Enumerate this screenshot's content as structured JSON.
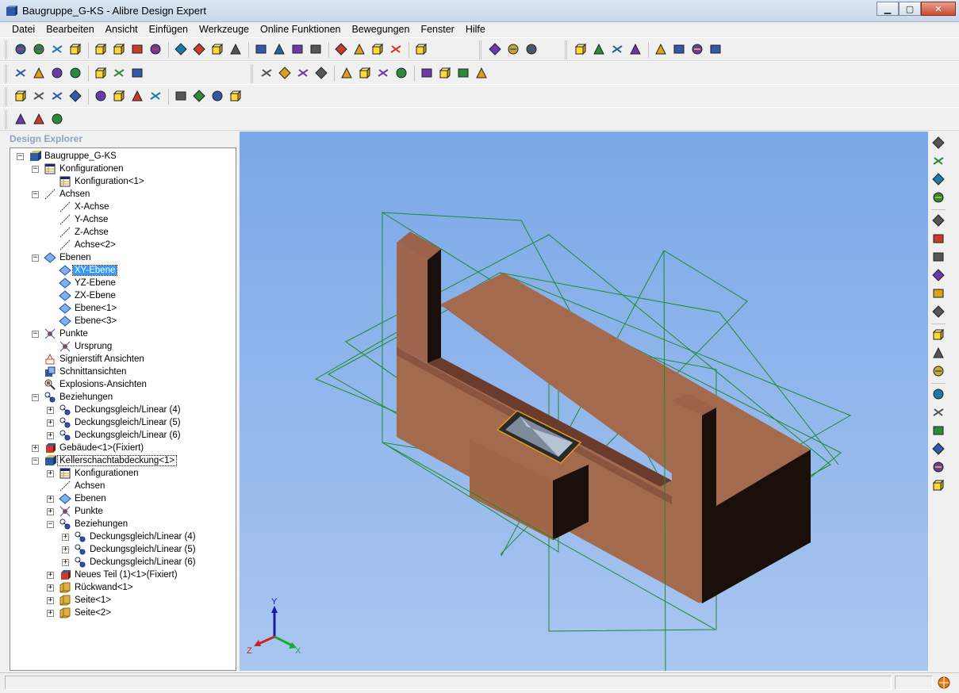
{
  "window": {
    "title": "Baugruppe_G-KS - Alibre Design Expert",
    "icon": "alibre-assembly-icon"
  },
  "menubar": [
    "Datei",
    "Bearbeiten",
    "Ansicht",
    "Einfügen",
    "Werkzeuge",
    "Online Funktionen",
    "Bewegungen",
    "Fenster",
    "Hilfe"
  ],
  "explorer": {
    "title": "Design Explorer",
    "tree": [
      {
        "level": 0,
        "toggle": "-",
        "icon": "assembly-icon",
        "label": "Baugruppe_G-KS"
      },
      {
        "level": 1,
        "toggle": "-",
        "icon": "configurations-icon",
        "label": "Konfigurationen"
      },
      {
        "level": 2,
        "toggle": "",
        "icon": "configuration-icon",
        "label": "Konfiguration<1>"
      },
      {
        "level": 1,
        "toggle": "-",
        "icon": "axes-icon",
        "label": "Achsen"
      },
      {
        "level": 2,
        "toggle": "",
        "icon": "axis-icon",
        "label": "X-Achse"
      },
      {
        "level": 2,
        "toggle": "",
        "icon": "axis-icon",
        "label": "Y-Achse"
      },
      {
        "level": 2,
        "toggle": "",
        "icon": "axis-icon",
        "label": "Z-Achse"
      },
      {
        "level": 2,
        "toggle": "",
        "icon": "axis-icon",
        "label": "Achse<2>"
      },
      {
        "level": 1,
        "toggle": "-",
        "icon": "planes-icon",
        "label": "Ebenen"
      },
      {
        "level": 2,
        "toggle": "",
        "icon": "plane-icon",
        "label": "XY-Ebene",
        "selected": true
      },
      {
        "level": 2,
        "toggle": "",
        "icon": "plane-icon",
        "label": "YZ-Ebene"
      },
      {
        "level": 2,
        "toggle": "",
        "icon": "plane-icon",
        "label": "ZX-Ebene"
      },
      {
        "level": 2,
        "toggle": "",
        "icon": "plane-icon",
        "label": "Ebene<1>"
      },
      {
        "level": 2,
        "toggle": "",
        "icon": "plane-icon",
        "label": "Ebene<3>"
      },
      {
        "level": 1,
        "toggle": "-",
        "icon": "points-icon",
        "label": "Punkte"
      },
      {
        "level": 2,
        "toggle": "",
        "icon": "point-icon",
        "label": "Ursprung"
      },
      {
        "level": 1,
        "toggle": "",
        "icon": "signature-pen-icon",
        "label": "Signierstift Ansichten"
      },
      {
        "level": 1,
        "toggle": "",
        "icon": "section-views-icon",
        "label": "Schnittansichten"
      },
      {
        "level": 1,
        "toggle": "",
        "icon": "exploded-views-icon",
        "label": "Explosions-Ansichten"
      },
      {
        "level": 1,
        "toggle": "-",
        "icon": "constraints-icon",
        "label": "Beziehungen"
      },
      {
        "level": 2,
        "toggle": "+",
        "icon": "constraint-icon",
        "label": "Deckungsgleich/Linear (4)"
      },
      {
        "level": 2,
        "toggle": "+",
        "icon": "constraint-icon",
        "label": "Deckungsgleich/Linear (5)"
      },
      {
        "level": 2,
        "toggle": "+",
        "icon": "constraint-icon",
        "label": "Deckungsgleich/Linear (6)"
      },
      {
        "level": 1,
        "toggle": "+",
        "icon": "part-fixed-icon",
        "label": "Gebäude<1>(Fixiert)"
      },
      {
        "level": 1,
        "toggle": "-",
        "icon": "subassembly-icon",
        "label": "Kellerschachtabdeckung<1>",
        "focused": true
      },
      {
        "level": 2,
        "toggle": "+",
        "icon": "configurations-icon",
        "label": "Konfigurationen"
      },
      {
        "level": 2,
        "toggle": "",
        "icon": "axes-icon",
        "label": "Achsen"
      },
      {
        "level": 2,
        "toggle": "+",
        "icon": "planes-icon",
        "label": "Ebenen"
      },
      {
        "level": 2,
        "toggle": "+",
        "icon": "points-icon",
        "label": "Punkte"
      },
      {
        "level": 2,
        "toggle": "-",
        "icon": "constraints-icon",
        "label": "Beziehungen"
      },
      {
        "level": 3,
        "toggle": "+",
        "icon": "constraint-icon",
        "label": "Deckungsgleich/Linear (4)"
      },
      {
        "level": 3,
        "toggle": "+",
        "icon": "constraint-icon",
        "label": "Deckungsgleich/Linear (5)"
      },
      {
        "level": 3,
        "toggle": "+",
        "icon": "constraint-icon",
        "label": "Deckungsgleich/Linear (6)"
      },
      {
        "level": 2,
        "toggle": "+",
        "icon": "part-fixed-icon",
        "label": "Neues Teil (1)<1>(Fixiert)"
      },
      {
        "level": 2,
        "toggle": "+",
        "icon": "sheet-part-icon",
        "label": "Rückwand<1>"
      },
      {
        "level": 2,
        "toggle": "+",
        "icon": "sheet-part-icon",
        "label": "Seite<1>"
      },
      {
        "level": 2,
        "toggle": "+",
        "icon": "sheet-part-icon",
        "label": "Seite<2>"
      }
    ]
  },
  "viewport": {
    "triad": {
      "x": "X",
      "y": "Y",
      "z": "Z"
    },
    "colors": {
      "background_top": "#7aa8e8",
      "background_bottom": "#a9c6f0",
      "solid": "#a46a4e",
      "shadow": "#1a0f0a",
      "planes": "#1f8a2a",
      "highlight": "#e59a1e"
    }
  },
  "toolbars": {
    "row1": [
      "new-icon",
      "open-icon",
      "save-icon",
      "paste-special-icon",
      "copy-special-icon",
      "print-icon",
      "print-preview-icon",
      "cut-icon",
      "copy-icon",
      "paste-icon",
      "delete-icon",
      "undo-icon",
      "redo-icon",
      "select-icon",
      "box-select-icon",
      "lasso-icon",
      "zoom-in-icon",
      "zoom-window-icon",
      "zoom-fit-icon",
      "previous-view-icon",
      "next-view-icon",
      "insert-part-icon",
      "insert-subassembly-icon",
      "render-icon",
      "plane-tool-icon",
      "axis-tool-icon",
      "point-tool-icon",
      "table-icon",
      "constraint-tool-icon",
      "measure-icon",
      "balance-icon",
      "interference-icon"
    ],
    "row2": [
      "part-color-icon",
      "assembly-color-icon",
      "sketch-icon",
      "sketch-3d-icon",
      "plane-sketch-icon",
      "point-sketch-icon",
      "marker-icon",
      "iso-view-icon",
      "front-view-icon",
      "back-view-icon",
      "left-view-icon",
      "right-view-icon",
      "top-view-icon",
      "bottom-view-icon",
      "grid-icon",
      "wireframe-icon",
      "shaded-icon",
      "magnet-icon",
      "origin-icon"
    ],
    "row3": [
      "assembly-tree-icon",
      "solid-icon",
      "explode-icon",
      "constraint-a-icon",
      "constraint-b-icon",
      "constraint-c-icon",
      "constraint-d-icon",
      "constraint-e-icon",
      "constraint-f-icon",
      "constraint-g-icon",
      "constraint-h-icon",
      "constraint-i-icon"
    ],
    "row4": [
      "pdf-icon",
      "animation-icon",
      "screenshot-icon"
    ],
    "right": [
      "view-cube-icon",
      "grid-dots-icon",
      "arrow-small-icon",
      "hexagon-icon",
      "gear-gray-icon",
      "insert-assembly-icon",
      "insert-part-right-icon",
      "add-part-icon",
      "replace-part-icon",
      "move-part-icon",
      "rotate-part-icon",
      "formula-icon",
      "gear-dim-icon",
      "paint-icon",
      "mate-a-icon",
      "mate-b-icon",
      "mate-c-icon",
      "mate-d-icon",
      "mate-e-icon"
    ]
  },
  "status": {
    "text": ""
  }
}
